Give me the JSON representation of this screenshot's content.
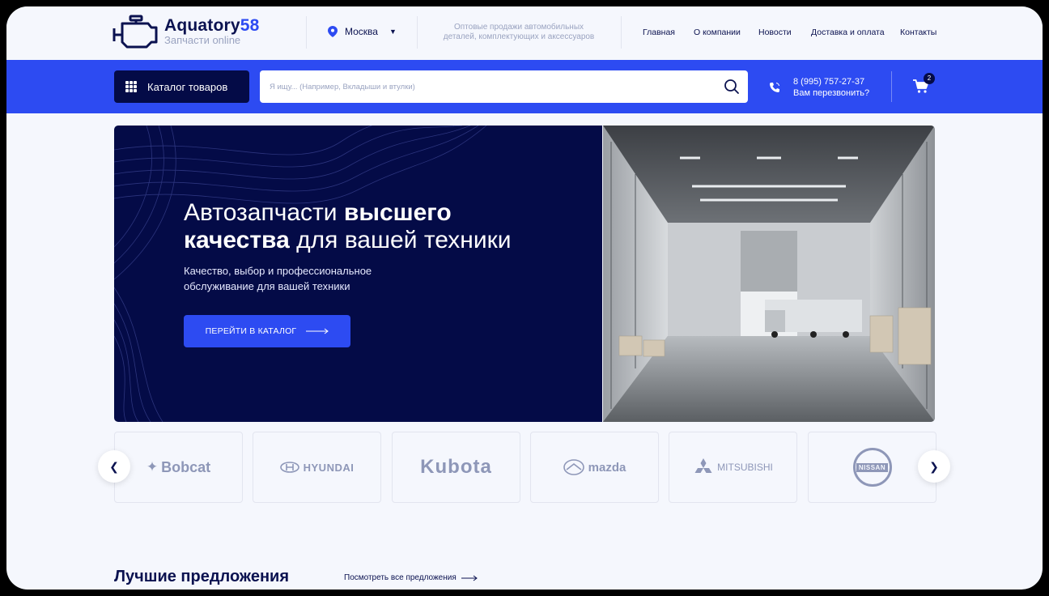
{
  "header": {
    "logo_title": "Aquatory",
    "logo_number": "58",
    "logo_subtitle": "Запчасти online",
    "city": "Москва",
    "tagline": "Оптовые продажи автомобильных деталей, комплектующих и аксессуаров",
    "nav": [
      "Главная",
      "О компании",
      "Новости",
      "Доставка и оплата",
      "Контакты"
    ]
  },
  "bar": {
    "catalog_label": "Каталог товаров",
    "search_placeholder": "Я ищу... (Например, Вкладыши и втулки)",
    "phone": "8 (995) 757-27-37",
    "callback": "Вам перезвонить?",
    "cart_count": "2"
  },
  "hero": {
    "title_part1": "Автозапчасти ",
    "title_bold1": "высшего",
    "title_bold2": "качества",
    "title_part2": " для вашей техники",
    "subtitle": "Качество, выбор и профессиональное обслуживание для вашей техники",
    "button_label": "ПЕРЕЙТИ В КАТАЛОГ"
  },
  "brands": [
    "Bobcat",
    "HYUNDAI",
    "Kubota",
    "mazda",
    "MITSUBISHI",
    "NISSAN"
  ],
  "best": {
    "title": "Лучшие предложения",
    "link": "Посмотреть все предложения"
  },
  "colors": {
    "accent": "#2d4bf2",
    "dark": "#040b47",
    "background": "#f5f7fd"
  }
}
